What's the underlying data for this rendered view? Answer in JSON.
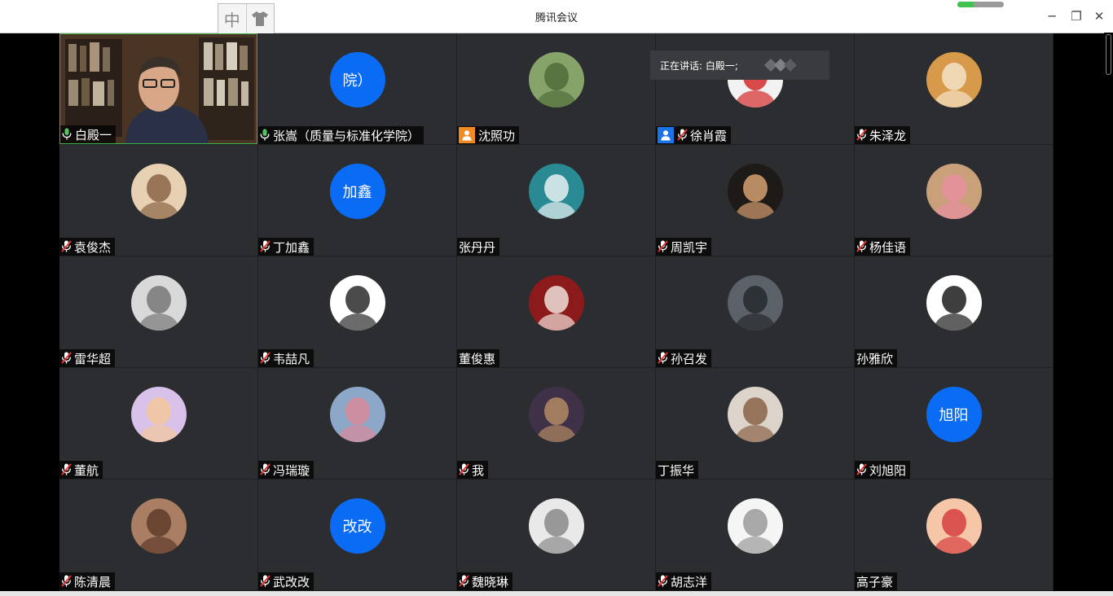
{
  "window": {
    "title": "腾讯会议",
    "controls": {
      "minimize": "─",
      "restore": "❐",
      "close": "✕"
    }
  },
  "ime": {
    "mode_label": "中",
    "skin_icon": "shirt-icon"
  },
  "network": {
    "signal_level": 0.35,
    "color": "#41c24f"
  },
  "speaking_banner": {
    "text": "正在讲话: 白殿一;"
  },
  "colors": {
    "accent_blue": "#0a6cf5",
    "active_border": "#3fb54b",
    "tile_bg": "#2c2d31"
  },
  "participants": [
    {
      "name": "白殿一",
      "mic": "on",
      "video": true
    },
    {
      "name": "张嵩（质量与标准化学院）",
      "mic": "on",
      "avatar_text": "院）"
    },
    {
      "name": "沈照功",
      "mic": "none",
      "badge": "host",
      "avatar_image": "hiker-photo"
    },
    {
      "name": "徐肖霞",
      "mic": "muted",
      "badge": "cohost",
      "avatar_image": "wuhan-banner-photo"
    },
    {
      "name": "朱泽龙",
      "mic": "muted",
      "avatar_image": "shiba-dog-photo"
    },
    {
      "name": "袁俊杰",
      "mic": "muted",
      "avatar_image": "portrait-photo"
    },
    {
      "name": "丁加鑫",
      "mic": "muted",
      "avatar_text": "加鑫"
    },
    {
      "name": "张丹丹",
      "mic": "none",
      "avatar_image": "eiffel-girl-illustration"
    },
    {
      "name": "周凯宇",
      "mic": "muted",
      "avatar_image": "classic-painting"
    },
    {
      "name": "杨佳语",
      "mic": "muted",
      "avatar_image": "cat-photo"
    },
    {
      "name": "雷华超",
      "mic": "muted",
      "avatar_image": "person-photo"
    },
    {
      "name": "韦喆凡",
      "mic": "muted",
      "avatar_image": "anime-boy"
    },
    {
      "name": "董俊惠",
      "mic": "none",
      "avatar_image": "anime-girl"
    },
    {
      "name": "孙召发",
      "mic": "muted",
      "avatar_image": "man-in-coat-photo"
    },
    {
      "name": "孙雅欣",
      "mic": "none",
      "avatar_image": "sketch-portrait"
    },
    {
      "name": "董航",
      "mic": "muted",
      "avatar_image": "cartoon-girl"
    },
    {
      "name": "冯瑞璇",
      "mic": "muted",
      "avatar_image": "boar-mask"
    },
    {
      "name": "我",
      "mic": "muted",
      "avatar_image": "dog-photo"
    },
    {
      "name": "丁振华",
      "mic": "none",
      "avatar_image": "young-man-photo"
    },
    {
      "name": "刘旭阳",
      "mic": "muted",
      "avatar_text": "旭阳"
    },
    {
      "name": "陈清晨",
      "mic": "muted",
      "avatar_image": "anime-character"
    },
    {
      "name": "武改改",
      "mic": "muted",
      "avatar_text": "改改"
    },
    {
      "name": "魏晓琳",
      "mic": "muted",
      "avatar_image": "white-hair-anime"
    },
    {
      "name": "胡志洋",
      "mic": "muted",
      "avatar_image": "manga-sketch"
    },
    {
      "name": "高子豪",
      "mic": "none",
      "avatar_image": "crayon-shinchan"
    }
  ]
}
